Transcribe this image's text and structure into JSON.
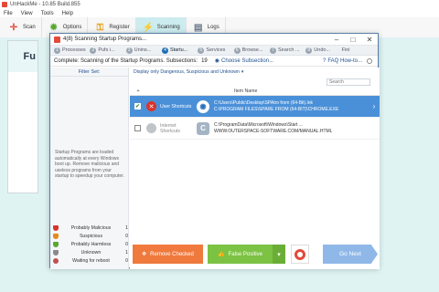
{
  "app": {
    "title": "UnHackMe - 10.85 Build.855",
    "menu": [
      "File",
      "View",
      "Tools",
      "Help"
    ],
    "toolbar": [
      {
        "label": "Scan",
        "icon": "crosshair-icon",
        "color": "#e34a3a"
      },
      {
        "label": "Options",
        "icon": "gear-icon",
        "color": "#5aa832"
      },
      {
        "label": "Register",
        "icon": "key-icon",
        "color": "#e3a21a"
      },
      {
        "label": "Scanning",
        "icon": "scan-icon",
        "color": "#2b9a8a"
      },
      {
        "label": "Logs",
        "icon": "log-icon",
        "color": "#6a7a8a"
      }
    ],
    "panel_heading": "Fu"
  },
  "dialog": {
    "title": "4(8) Scanning Startup Programs...",
    "steps": [
      {
        "num": "1",
        "label": "Processes"
      },
      {
        "num": "2",
        "label": "Pufs i..."
      },
      {
        "num": "3",
        "label": "Unins..."
      },
      {
        "num": "4",
        "label": "Startu..."
      },
      {
        "num": "5",
        "label": "Services"
      },
      {
        "num": "6",
        "label": "Browse..."
      },
      {
        "num": "7",
        "label": "Search ..."
      },
      {
        "num": "8",
        "label": "Undo..."
      },
      {
        "num": "",
        "label": "Fini"
      }
    ],
    "active_step": 3,
    "complete_text": "Complete: Scanning of the Startup Programs. Subsections:",
    "progress": "19",
    "subsections_button": "Choose Subsection...",
    "faq": "FAQ How-to..."
  },
  "left": {
    "filter_label": "Filter Set:",
    "description": "Startup Programs are loaded automatically at every Windows boot up.\nRemove malicious and useless programs from your startup to speedup your computer.",
    "legend": [
      {
        "label": "Probably Malicious",
        "count": "1",
        "color": "#d9342b"
      },
      {
        "label": "Suspicious",
        "count": "0",
        "color": "#e38a1a"
      },
      {
        "label": "Probably Harmless",
        "count": "0",
        "color": "#5aa832"
      },
      {
        "label": "Unknown",
        "count": "1",
        "color": "#8a8a8a"
      },
      {
        "label": "Waiting for reboot",
        "count": "0",
        "color": "#c05050"
      }
    ]
  },
  "list": {
    "filter_text": "Display only Dangerous, Suspicious and Unknown",
    "search_placeholder": "Search",
    "col_name": "Item Name",
    "rows": [
      {
        "checked": true,
        "type": "User Shortcuts",
        "path1": "C:\\Users\\Public\\Desktop\\SPAtro from (64-Bit).lnk",
        "path2": "C:\\PROGRAM FILES\\SPARE FROM (64-BIT)\\CHROME.EXE",
        "status_color": "#d9342b",
        "app_color": "#2a6fc0"
      },
      {
        "checked": false,
        "type": "Internet Shortcuts",
        "path1": "C:\\ProgramData\\Microsoft\\Windows\\Start ...",
        "path2": "WWW.OUTERSPACE-SOFTWARE.COM/MANUAL.HTML",
        "status_color": "#9aa0a6",
        "app_color": "#8aa0b0"
      }
    ]
  },
  "buttons": {
    "remove": "Remove Checked",
    "false_positive": "False Positive",
    "next": "Go Next"
  }
}
